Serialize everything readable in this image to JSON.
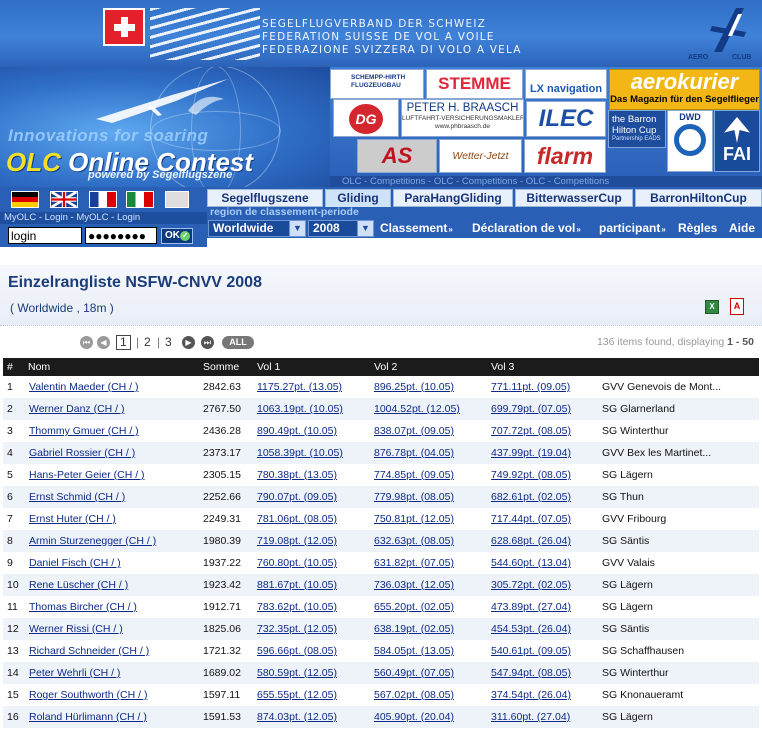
{
  "banner": {
    "line1": "SEGELFLUGVERBAND DER SCHWEIZ",
    "line2": "FEDERATION SUISSE DE VOL A VOILE",
    "line3": "FEDERAZIONE SVIZZERA DI VOLO A VELA",
    "aero": "AERO",
    "club": "CLUB"
  },
  "logo": {
    "tagline": "Innovations for soaring",
    "olc": "OLC",
    "title": "Online Contest",
    "powered": "powered by Segelflugszene"
  },
  "sponsors": {
    "schempp": "SCHEMPP-HIRTH FLUGZEUGBAU",
    "stemme": "STEMME",
    "lx": "LX navigation",
    "aerokurier": "aerokurier",
    "aerokurier_sub": "Das Magazin für den Segelflieger",
    "braasch_name": "PETER H. BRAASCH",
    "braasch_sub": "LUFTFAHRT-VERSICHERUNGSMAKLER",
    "braasch_url": "www.phbraasch.de",
    "ilec": "ILEC",
    "barron_line1": "the Barron",
    "barron_line2": "Hilton Cup",
    "barron_line3": "Partnership EADS",
    "dwd": "DWD",
    "fai": "FAI",
    "as": "AS",
    "wetter": "Wetter-Jetzt",
    "flarm": "flarm",
    "competitions": "OLC - Competitions - OLC - Competitions - OLC - Competitions"
  },
  "myolc": {
    "bar": "MyOLC - Login - MyOLC - Login",
    "login_value": "login",
    "password_value": "●●●●●●●●",
    "ok": "OK"
  },
  "tabs": [
    "Segelflugszene",
    "Gliding",
    "ParaHangGliding",
    "BitterwasserCup",
    "BarronHiltonCup"
  ],
  "active_tab": "Gliding",
  "region_label": "region de classement-periode",
  "menubar": {
    "region": "Worldwide",
    "year": "2008",
    "items": [
      "Classement",
      "Déclaration de vol",
      "participant",
      "Règles",
      "Aide"
    ]
  },
  "page": {
    "title": "Einzelrangliste NSFW-CNVV 2008",
    "subtitle": "( Worldwide , 18m )",
    "excel": "X",
    "pdf": "A"
  },
  "pager": {
    "current": "1",
    "pages": [
      "2",
      "3"
    ],
    "sep1": "|",
    "sep2": "|",
    "all": "ALL",
    "found_prefix": "136 items found, displaying ",
    "found_range": "1 - 50"
  },
  "table": {
    "headers": {
      "num": "#",
      "name": "Nom",
      "sum": "Somme",
      "v1": "Vol 1",
      "v2": "Vol 2",
      "v3": "Vol 3"
    },
    "rows": [
      {
        "rank": "1",
        "name": "Valentin Maeder (CH / )",
        "sum": "2842.63",
        "v1": "1175.27pt. (13.05)",
        "v2": "896.25pt. (10.05)",
        "v3": "771.11pt. (09.05)",
        "club": "GVV Genevois de Mont..."
      },
      {
        "rank": "2",
        "name": "Werner Danz (CH / )",
        "sum": "2767.50",
        "v1": "1063.19pt. (10.05)",
        "v2": "1004.52pt. (12.05)",
        "v3": "699.79pt. (07.05)",
        "club": "SG Glarnerland"
      },
      {
        "rank": "3",
        "name": "Thommy Gmuer (CH / )",
        "sum": "2436.28",
        "v1": "890.49pt. (10.05)",
        "v2": "838.07pt. (09.05)",
        "v3": "707.72pt. (08.05)",
        "club": "SG Winterthur"
      },
      {
        "rank": "4",
        "name": "Gabriel Rossier (CH / )",
        "sum": "2373.17",
        "v1": "1058.39pt. (10.05)",
        "v2": "876.78pt. (04.05)",
        "v3": "437.99pt. (19.04)",
        "club": "GVV Bex les Martinet..."
      },
      {
        "rank": "5",
        "name": "Hans-Peter Geier (CH / )",
        "sum": "2305.15",
        "v1": "780.38pt. (13.05)",
        "v2": "774.85pt. (09.05)",
        "v3": "749.92pt. (08.05)",
        "club": "SG Lägern"
      },
      {
        "rank": "6",
        "name": "Ernst Schmid (CH / )",
        "sum": "2252.66",
        "v1": "790.07pt. (09.05)",
        "v2": "779.98pt. (08.05)",
        "v3": "682.61pt. (02.05)",
        "club": "SG Thun"
      },
      {
        "rank": "7",
        "name": "Ernst Huter (CH / )",
        "sum": "2249.31",
        "v1": "781.06pt. (08.05)",
        "v2": "750.81pt. (12.05)",
        "v3": "717.44pt. (07.05)",
        "club": "GVV Fribourg"
      },
      {
        "rank": "8",
        "name": "Armin Sturzenegger (CH / )",
        "sum": "1980.39",
        "v1": "719.08pt. (12.05)",
        "v2": "632.63pt. (08.05)",
        "v3": "628.68pt. (26.04)",
        "club": "SG Säntis"
      },
      {
        "rank": "9",
        "name": "Daniel Fisch (CH / )",
        "sum": "1937.22",
        "v1": "760.80pt. (10.05)",
        "v2": "631.82pt. (07.05)",
        "v3": "544.60pt. (13.04)",
        "club": "GVV Valais"
      },
      {
        "rank": "10",
        "name": "Rene Lüscher (CH / )",
        "sum": "1923.42",
        "v1": "881.67pt. (10.05)",
        "v2": "736.03pt. (12.05)",
        "v3": "305.72pt. (02.05)",
        "club": "SG Lägern"
      },
      {
        "rank": "11",
        "name": "Thomas Bircher (CH / )",
        "sum": "1912.71",
        "v1": "783.62pt. (10.05)",
        "v2": "655.20pt. (02.05)",
        "v3": "473.89pt. (27.04)",
        "club": "SG Lägern"
      },
      {
        "rank": "12",
        "name": "Werner Rissi (CH / )",
        "sum": "1825.06",
        "v1": "732.35pt. (12.05)",
        "v2": "638.19pt. (02.05)",
        "v3": "454.53pt. (26.04)",
        "club": "SG Säntis"
      },
      {
        "rank": "13",
        "name": "Richard Schneider (CH / )",
        "sum": "1721.32",
        "v1": "596.66pt. (08.05)",
        "v2": "584.05pt. (13.05)",
        "v3": "540.61pt. (09.05)",
        "club": "SG Schaffhausen"
      },
      {
        "rank": "14",
        "name": "Peter Wehrli (CH / )",
        "sum": "1689.02",
        "v1": "580.59pt. (12.05)",
        "v2": "560.49pt. (07.05)",
        "v3": "547.94pt. (08.05)",
        "club": "SG Winterthur"
      },
      {
        "rank": "15",
        "name": "Roger Southworth (CH / )",
        "sum": "1597.11",
        "v1": "655.55pt. (12.05)",
        "v2": "567.02pt. (08.05)",
        "v3": "374.54pt. (26.04)",
        "club": "SG Knonaueramt"
      },
      {
        "rank": "16",
        "name": "Roland Hürlimann (CH / )",
        "sum": "1591.53",
        "v1": "874.03pt. (12.05)",
        "v2": "405.90pt. (20.04)",
        "v3": "311.60pt. (27.04)",
        "club": "SG Lägern"
      }
    ]
  },
  "colors": {
    "header_blue": "#2a5fb6",
    "title_blue": "#1b3c7a",
    "link_blue": "#0b2a88",
    "table_header": "#1b1b1b",
    "row_alt": "#eef3fa"
  }
}
